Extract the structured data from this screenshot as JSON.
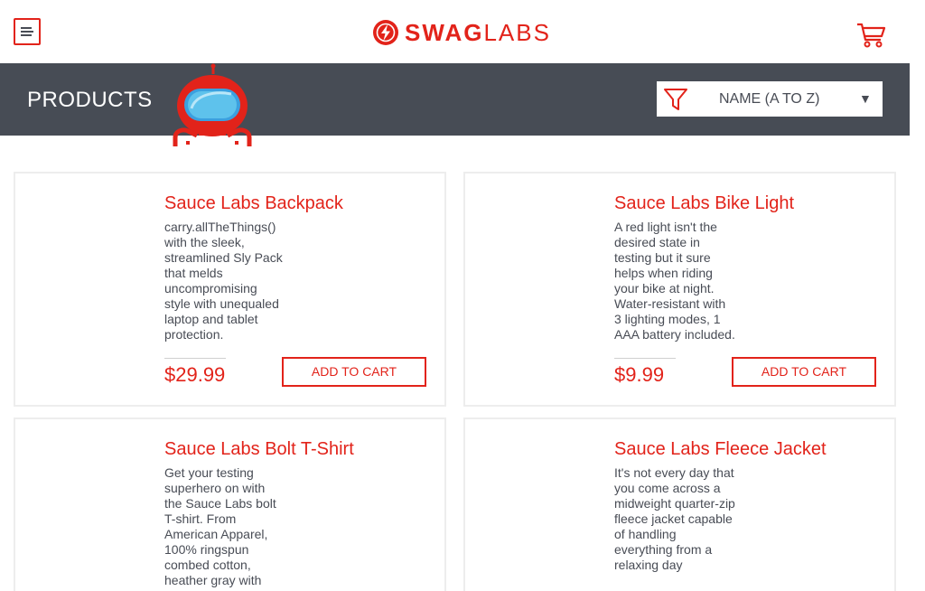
{
  "app": {
    "logo_bold": "SWAG",
    "logo_light": "LABS"
  },
  "header": {
    "title": "PRODUCTS",
    "sort": {
      "selected": "NAME (A TO Z)"
    }
  },
  "products": [
    {
      "name": "Sauce Labs Backpack",
      "description": "carry.allTheThings() with the sleek, streamlined Sly Pack that melds uncompromising style with unequaled laptop and tablet protection.",
      "price": "$29.99",
      "button": "ADD TO CART"
    },
    {
      "name": "Sauce Labs Bike Light",
      "description": "A red light isn't the desired state in testing but it sure helps when riding your bike at night. Water-resistant with 3 lighting modes, 1 AAA battery included.",
      "price": "$9.99",
      "button": "ADD TO CART"
    },
    {
      "name": "Sauce Labs Bolt T-Shirt",
      "description": "Get your testing superhero on with the Sauce Labs bolt T-shirt. From American Apparel, 100% ringspun combed cotton, heather gray with"
    },
    {
      "name": "Sauce Labs Fleece Jacket",
      "description": "It's not every day that you come across a midweight quarter-zip fleece jacket capable of handling everything from a relaxing day"
    }
  ],
  "colors": {
    "accent": "#e2231a",
    "header_bg": "#474c55",
    "text": "#484c55"
  },
  "icons": [
    "menu-icon",
    "swag-labs-logo-icon",
    "cart-icon",
    "robot-mascot",
    "filter-icon",
    "caret-down-icon"
  ]
}
